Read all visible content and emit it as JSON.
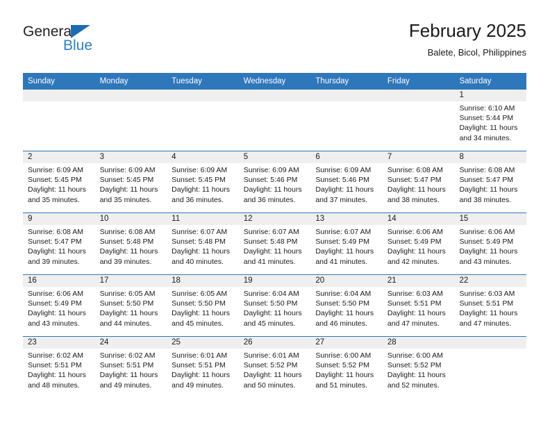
{
  "brand": {
    "name_top": "General",
    "name_bottom": "Blue",
    "triangle_color": "#1b6cb3",
    "blue_color": "#2980d0"
  },
  "header": {
    "title": "February 2025",
    "subtitle": "Balete, Bicol, Philippines"
  },
  "theme": {
    "header_bar_color": "#2e77bb",
    "day_band_color": "#efefef",
    "text_color": "#1a1a1a"
  },
  "weekdays": [
    "Sunday",
    "Monday",
    "Tuesday",
    "Wednesday",
    "Thursday",
    "Friday",
    "Saturday"
  ],
  "weeks": [
    [
      {
        "day": ""
      },
      {
        "day": ""
      },
      {
        "day": ""
      },
      {
        "day": ""
      },
      {
        "day": ""
      },
      {
        "day": ""
      },
      {
        "day": "1",
        "sunrise": "Sunrise: 6:10 AM",
        "sunset": "Sunset: 5:44 PM",
        "daylight": "Daylight: 11 hours and 34 minutes."
      }
    ],
    [
      {
        "day": "2",
        "sunrise": "Sunrise: 6:09 AM",
        "sunset": "Sunset: 5:45 PM",
        "daylight": "Daylight: 11 hours and 35 minutes."
      },
      {
        "day": "3",
        "sunrise": "Sunrise: 6:09 AM",
        "sunset": "Sunset: 5:45 PM",
        "daylight": "Daylight: 11 hours and 35 minutes."
      },
      {
        "day": "4",
        "sunrise": "Sunrise: 6:09 AM",
        "sunset": "Sunset: 5:45 PM",
        "daylight": "Daylight: 11 hours and 36 minutes."
      },
      {
        "day": "5",
        "sunrise": "Sunrise: 6:09 AM",
        "sunset": "Sunset: 5:46 PM",
        "daylight": "Daylight: 11 hours and 36 minutes."
      },
      {
        "day": "6",
        "sunrise": "Sunrise: 6:09 AM",
        "sunset": "Sunset: 5:46 PM",
        "daylight": "Daylight: 11 hours and 37 minutes."
      },
      {
        "day": "7",
        "sunrise": "Sunrise: 6:08 AM",
        "sunset": "Sunset: 5:47 PM",
        "daylight": "Daylight: 11 hours and 38 minutes."
      },
      {
        "day": "8",
        "sunrise": "Sunrise: 6:08 AM",
        "sunset": "Sunset: 5:47 PM",
        "daylight": "Daylight: 11 hours and 38 minutes."
      }
    ],
    [
      {
        "day": "9",
        "sunrise": "Sunrise: 6:08 AM",
        "sunset": "Sunset: 5:47 PM",
        "daylight": "Daylight: 11 hours and 39 minutes."
      },
      {
        "day": "10",
        "sunrise": "Sunrise: 6:08 AM",
        "sunset": "Sunset: 5:48 PM",
        "daylight": "Daylight: 11 hours and 39 minutes."
      },
      {
        "day": "11",
        "sunrise": "Sunrise: 6:07 AM",
        "sunset": "Sunset: 5:48 PM",
        "daylight": "Daylight: 11 hours and 40 minutes."
      },
      {
        "day": "12",
        "sunrise": "Sunrise: 6:07 AM",
        "sunset": "Sunset: 5:48 PM",
        "daylight": "Daylight: 11 hours and 41 minutes."
      },
      {
        "day": "13",
        "sunrise": "Sunrise: 6:07 AM",
        "sunset": "Sunset: 5:49 PM",
        "daylight": "Daylight: 11 hours and 41 minutes."
      },
      {
        "day": "14",
        "sunrise": "Sunrise: 6:06 AM",
        "sunset": "Sunset: 5:49 PM",
        "daylight": "Daylight: 11 hours and 42 minutes."
      },
      {
        "day": "15",
        "sunrise": "Sunrise: 6:06 AM",
        "sunset": "Sunset: 5:49 PM",
        "daylight": "Daylight: 11 hours and 43 minutes."
      }
    ],
    [
      {
        "day": "16",
        "sunrise": "Sunrise: 6:06 AM",
        "sunset": "Sunset: 5:49 PM",
        "daylight": "Daylight: 11 hours and 43 minutes."
      },
      {
        "day": "17",
        "sunrise": "Sunrise: 6:05 AM",
        "sunset": "Sunset: 5:50 PM",
        "daylight": "Daylight: 11 hours and 44 minutes."
      },
      {
        "day": "18",
        "sunrise": "Sunrise: 6:05 AM",
        "sunset": "Sunset: 5:50 PM",
        "daylight": "Daylight: 11 hours and 45 minutes."
      },
      {
        "day": "19",
        "sunrise": "Sunrise: 6:04 AM",
        "sunset": "Sunset: 5:50 PM",
        "daylight": "Daylight: 11 hours and 45 minutes."
      },
      {
        "day": "20",
        "sunrise": "Sunrise: 6:04 AM",
        "sunset": "Sunset: 5:50 PM",
        "daylight": "Daylight: 11 hours and 46 minutes."
      },
      {
        "day": "21",
        "sunrise": "Sunrise: 6:03 AM",
        "sunset": "Sunset: 5:51 PM",
        "daylight": "Daylight: 11 hours and 47 minutes."
      },
      {
        "day": "22",
        "sunrise": "Sunrise: 6:03 AM",
        "sunset": "Sunset: 5:51 PM",
        "daylight": "Daylight: 11 hours and 47 minutes."
      }
    ],
    [
      {
        "day": "23",
        "sunrise": "Sunrise: 6:02 AM",
        "sunset": "Sunset: 5:51 PM",
        "daylight": "Daylight: 11 hours and 48 minutes."
      },
      {
        "day": "24",
        "sunrise": "Sunrise: 6:02 AM",
        "sunset": "Sunset: 5:51 PM",
        "daylight": "Daylight: 11 hours and 49 minutes."
      },
      {
        "day": "25",
        "sunrise": "Sunrise: 6:01 AM",
        "sunset": "Sunset: 5:51 PM",
        "daylight": "Daylight: 11 hours and 49 minutes."
      },
      {
        "day": "26",
        "sunrise": "Sunrise: 6:01 AM",
        "sunset": "Sunset: 5:52 PM",
        "daylight": "Daylight: 11 hours and 50 minutes."
      },
      {
        "day": "27",
        "sunrise": "Sunrise: 6:00 AM",
        "sunset": "Sunset: 5:52 PM",
        "daylight": "Daylight: 11 hours and 51 minutes."
      },
      {
        "day": "28",
        "sunrise": "Sunrise: 6:00 AM",
        "sunset": "Sunset: 5:52 PM",
        "daylight": "Daylight: 11 hours and 52 minutes."
      },
      {
        "day": ""
      }
    ]
  ]
}
